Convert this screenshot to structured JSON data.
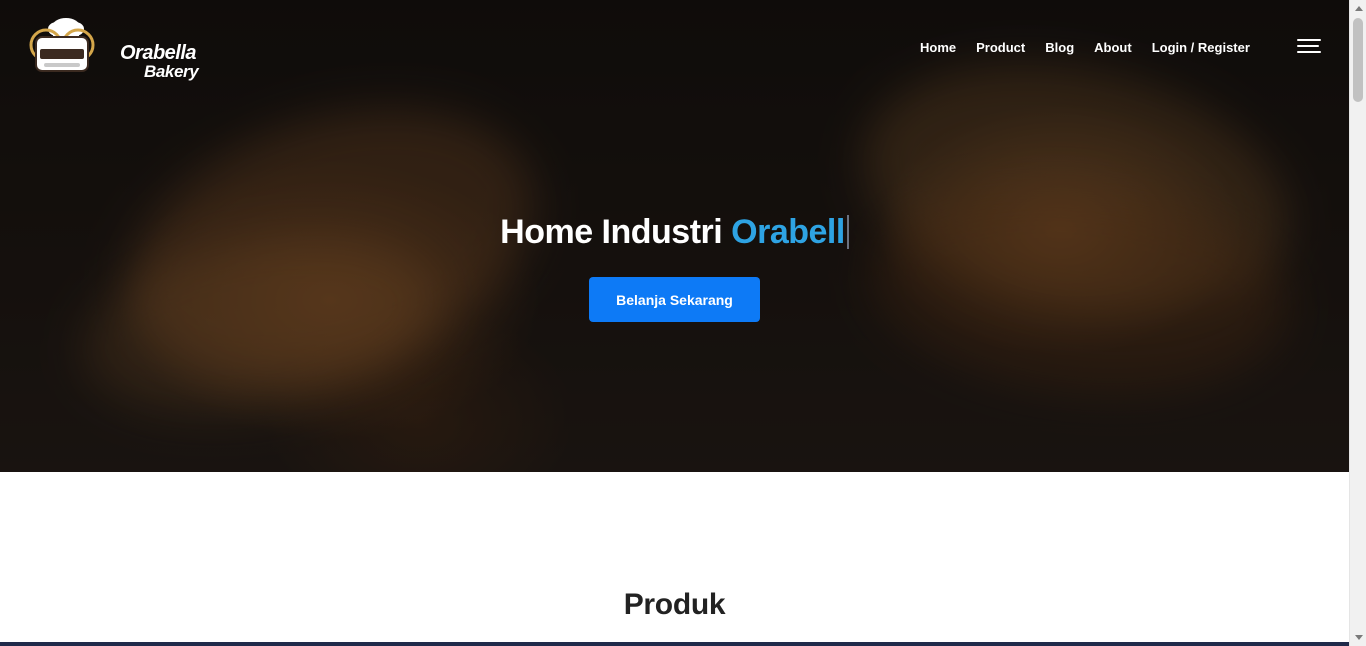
{
  "brand": {
    "name_line1": "Orabella",
    "name_line2": "Bakery"
  },
  "nav": {
    "items": [
      {
        "label": "Home"
      },
      {
        "label": "Product"
      },
      {
        "label": "Blog"
      },
      {
        "label": "About"
      },
      {
        "label": "Login / Register"
      }
    ],
    "menu_icon": "hamburger-menu-icon"
  },
  "hero": {
    "title_prefix": "Home Industri ",
    "title_highlight": "Orabell",
    "cta_label": "Belanja Sekarang"
  },
  "section": {
    "title": "Produk"
  },
  "colors": {
    "accent": "#2ea3e3",
    "button": "#0d7af6"
  }
}
